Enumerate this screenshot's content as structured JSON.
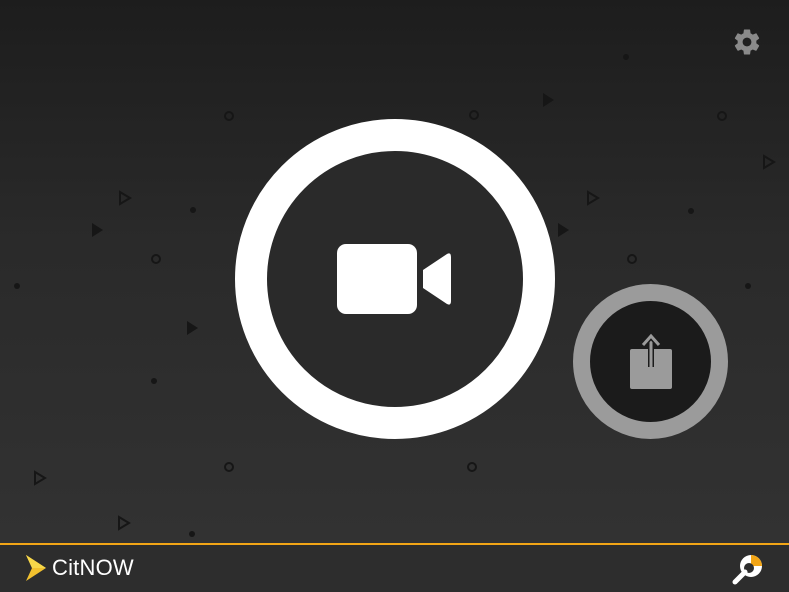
{
  "app": {
    "brand": "CitNOW",
    "accent_color": "#f2a516"
  },
  "controls": {
    "settings_icon": "gear-icon",
    "record_icon": "video-camera-icon",
    "share_icon": "upload-share-icon",
    "footer_icon": "wrench-pie-icon"
  },
  "colors": {
    "background": "#2a2a2a",
    "record_ring": "#ffffff",
    "share_ring": "#9b9b9b",
    "share_icon": "#9b9b9b"
  }
}
